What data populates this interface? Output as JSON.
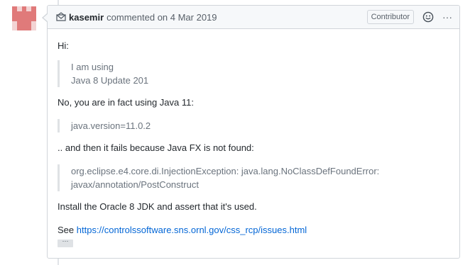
{
  "comment": {
    "author": "kasemir",
    "action": "commented on 4 Mar 2019",
    "role_badge": "Contributor",
    "more_label": "···"
  },
  "body": {
    "greeting": "Hi:",
    "quote1": [
      "I am using",
      "Java 8 Update 201"
    ],
    "para2": "No, you are in fact using Java 11:",
    "quote2": "java.version=11.0.2",
    "para3": ".. and then it fails because Java FX is not found:",
    "quote3": [
      "org.eclipse.e4.core.di.InjectionException: java.lang.NoClassDefFoundError:",
      "javax/annotation/PostConstruct"
    ],
    "para4": "Install the Oracle 8 JDK and assert that it's used.",
    "see_label": "See",
    "link": "https://controlssoftware.sns.ornl.gov/css_rcp/issues.html",
    "ellipsis_label": "···"
  },
  "colors": {
    "link": "#0366d6",
    "avatar": "#e07a7a"
  },
  "icons": {
    "header_left": "mail-icon",
    "reaction": "smiley-icon",
    "more": "kebab-horizontal-icon"
  }
}
